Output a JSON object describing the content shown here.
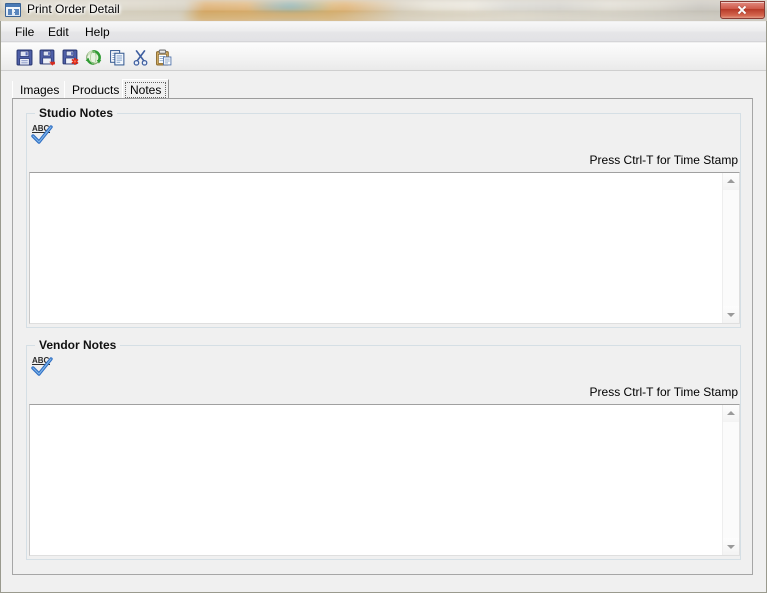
{
  "window": {
    "title": "Print Order Detail",
    "app_icon": "form-icon",
    "close_label": "Close",
    "close_glyph": "x"
  },
  "menubar": {
    "items": [
      {
        "label": "File",
        "name": "menu-file"
      },
      {
        "label": "Edit",
        "name": "menu-edit"
      },
      {
        "label": "Help",
        "name": "menu-help"
      }
    ]
  },
  "toolbar": {
    "buttons": [
      {
        "name": "save-button",
        "icon": "floppy-disk-save-icon",
        "title": "Save"
      },
      {
        "name": "save-as-button",
        "icon": "floppy-disk-arrow-icon",
        "title": "Save As"
      },
      {
        "name": "save-all-button",
        "icon": "floppy-disk-asterisk-icon",
        "title": "Save All"
      },
      {
        "name": "refresh-button",
        "icon": "refresh-globe-icon",
        "title": "Refresh"
      },
      {
        "name": "copy-button",
        "icon": "copy-pages-icon",
        "title": "Copy"
      },
      {
        "name": "cut-button",
        "icon": "scissors-icon",
        "title": "Cut"
      },
      {
        "name": "paste-button",
        "icon": "clipboard-paste-icon",
        "title": "Paste"
      }
    ]
  },
  "tabs": {
    "items": [
      {
        "label": "Images",
        "name": "tab-images",
        "selected": false
      },
      {
        "label": "Products",
        "name": "tab-products",
        "selected": false
      },
      {
        "label": "Notes",
        "name": "tab-notes",
        "selected": true
      }
    ]
  },
  "notes_tab": {
    "studio": {
      "group_label": "Studio Notes",
      "spellcheck_icon": "spellcheck-abc-icon",
      "hint": "Press Ctrl-T for Time Stamp",
      "value": "",
      "placeholder": ""
    },
    "vendor": {
      "group_label": "Vendor Notes",
      "spellcheck_icon": "spellcheck-abc-icon",
      "hint": "Press Ctrl-T for Time Stamp",
      "value": "",
      "placeholder": ""
    }
  },
  "colors": {
    "window_bg": "#f0f0f0",
    "groupbox_border": "#d5dfe5",
    "close_button": "#c0432f",
    "accent_blue": "#3c6494",
    "desktop_blur": "#cdc6b2"
  }
}
